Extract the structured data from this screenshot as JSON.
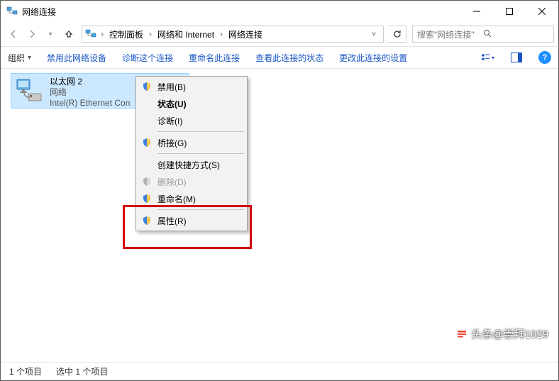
{
  "window": {
    "title": "网络连接"
  },
  "breadcrumb": {
    "p0": "控制面板",
    "p1": "网络和 Internet",
    "p2": "网络连接"
  },
  "search": {
    "placeholder": "搜索\"网络连接\""
  },
  "toolbar": {
    "organize": "组织",
    "disable": "禁用此网络设备",
    "diagnose": "诊断这个连接",
    "rename": "重命名此连接",
    "viewstatus": "查看此连接的状态",
    "changeset": "更改此连接的设置"
  },
  "connection": {
    "name": "以太网 2",
    "net": "网络",
    "adapter": "Intel(R) Ethernet Con"
  },
  "menu": {
    "disable": "禁用(B)",
    "status": "状态(U)",
    "diagnose": "诊断(I)",
    "bridge": "桥接(G)",
    "shortcut": "创建快捷方式(S)",
    "delete": "删除(D)",
    "rename": "重命名(M)",
    "properties": "属性(R)"
  },
  "status": {
    "count": "1 个项目",
    "selected": "选中 1 个项目"
  },
  "watermark": {
    "text": "头条@崇拜1029"
  }
}
